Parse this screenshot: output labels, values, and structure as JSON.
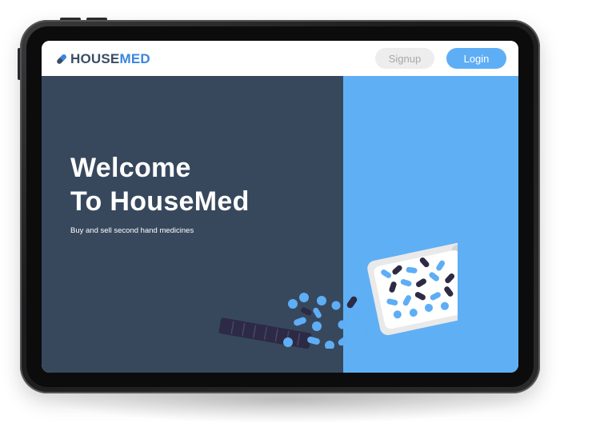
{
  "app": {
    "logo": {
      "part1": "HOUSE",
      "part2": "MED",
      "icon": "pill-icon"
    },
    "nav": {
      "signup_label": "Signup",
      "login_label": "Login"
    },
    "hero": {
      "title_line1": "Welcome",
      "title_line2": "To HouseMed",
      "subtitle": "Buy and sell second hand medicines"
    },
    "colors": {
      "hero_dark": "#37485d",
      "hero_light": "#5faff5",
      "accent": "#3a86e0",
      "login_button": "#5eaef5",
      "signup_button": "#ededed"
    },
    "illustration": {
      "name": "spilled-pill-bottle-illustration"
    }
  }
}
